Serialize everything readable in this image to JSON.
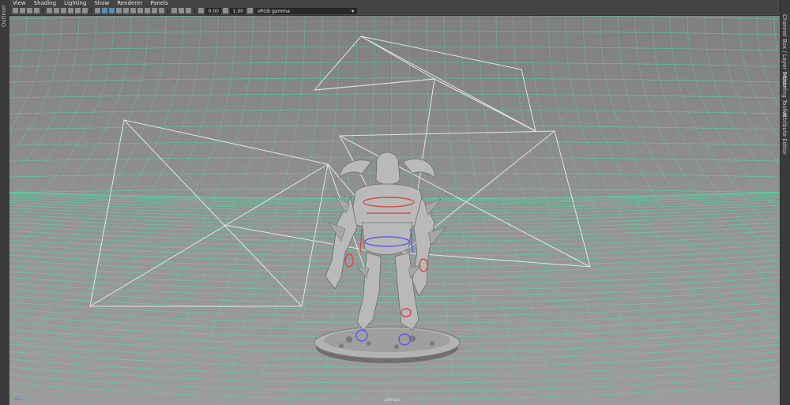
{
  "menu": [
    "View",
    "Shading",
    "Lighting",
    "Show",
    "Renderer",
    "Panels"
  ],
  "toolbar": {
    "field1": "0.00",
    "field2": "1.00",
    "color_space": "sRGB gamma"
  },
  "left_panel_label": "Outliner",
  "right_tabs": [
    "Channel Box / Layer Editor",
    "Modeling Toolkit",
    "Attribute Editor"
  ],
  "viewport": {
    "camera_label": "persp1"
  },
  "colors": {
    "grid": "#4fe0a6",
    "background": "#8f8f8f",
    "rig_red": "#d24a4a",
    "rig_blue": "#5a5ae8"
  },
  "icons": [
    "select-icon",
    "lasso-icon",
    "paint-icon",
    "move-icon",
    "rotate-icon",
    "scale-icon",
    "camera-icon",
    "grid-icon",
    "wireframe-icon",
    "smooth-shade-icon",
    "texture-icon",
    "light-icon",
    "shadow-icon",
    "isolate-icon",
    "xray-icon",
    "resolution-gate-icon",
    "exposure-icon",
    "gamma-icon"
  ]
}
